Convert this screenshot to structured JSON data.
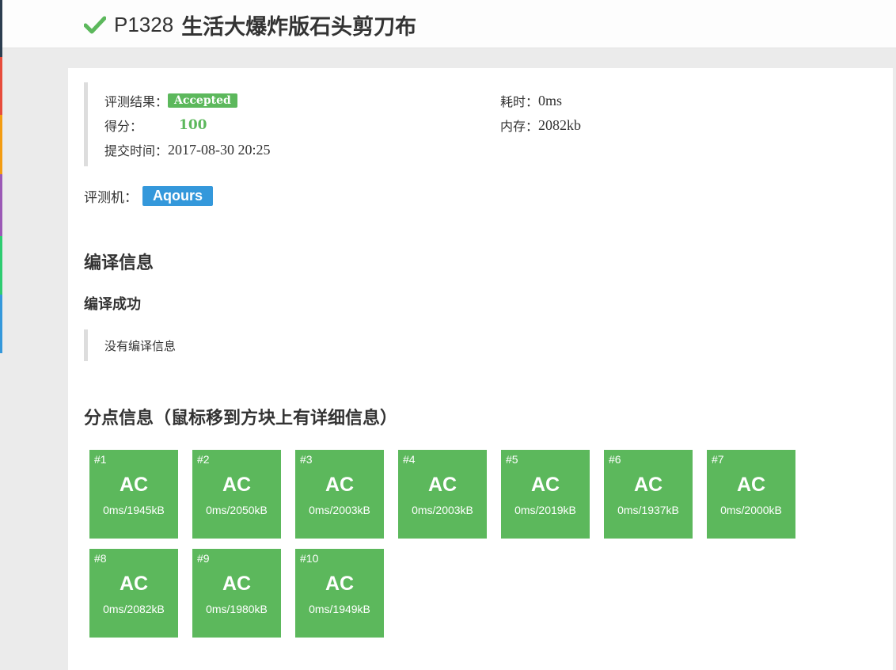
{
  "header": {
    "problem_id": "P1328",
    "problem_title": "生活大爆炸版石头剪刀布"
  },
  "summary": {
    "result_label": "评测结果：",
    "result_value": "Accepted",
    "score_label": "得分：",
    "score_value": "100",
    "submit_time_label": "提交时间：",
    "submit_time_value": "2017-08-30 20:25",
    "time_label": "耗时：",
    "time_value": "0ms",
    "memory_label": "内存：",
    "memory_value": "2082kb"
  },
  "judger": {
    "label": "评测机：",
    "value": "Aqours"
  },
  "compile": {
    "heading": "编译信息",
    "status": "编译成功",
    "message": "没有编译信息"
  },
  "points": {
    "heading": "分点信息（鼠标移到方块上有详细信息）",
    "items": [
      {
        "num": "#1",
        "status": "AC",
        "detail": "0ms/1945kB"
      },
      {
        "num": "#2",
        "status": "AC",
        "detail": "0ms/2050kB"
      },
      {
        "num": "#3",
        "status": "AC",
        "detail": "0ms/2003kB"
      },
      {
        "num": "#4",
        "status": "AC",
        "detail": "0ms/2003kB"
      },
      {
        "num": "#5",
        "status": "AC",
        "detail": "0ms/2019kB"
      },
      {
        "num": "#6",
        "status": "AC",
        "detail": "0ms/1937kB"
      },
      {
        "num": "#7",
        "status": "AC",
        "detail": "0ms/2000kB"
      },
      {
        "num": "#8",
        "status": "AC",
        "detail": "0ms/2082kB"
      },
      {
        "num": "#9",
        "status": "AC",
        "detail": "0ms/1980kB"
      },
      {
        "num": "#10",
        "status": "AC",
        "detail": "0ms/1949kB"
      }
    ]
  },
  "colors": {
    "accepted": "#5cb85c",
    "judger": "#3498db"
  }
}
